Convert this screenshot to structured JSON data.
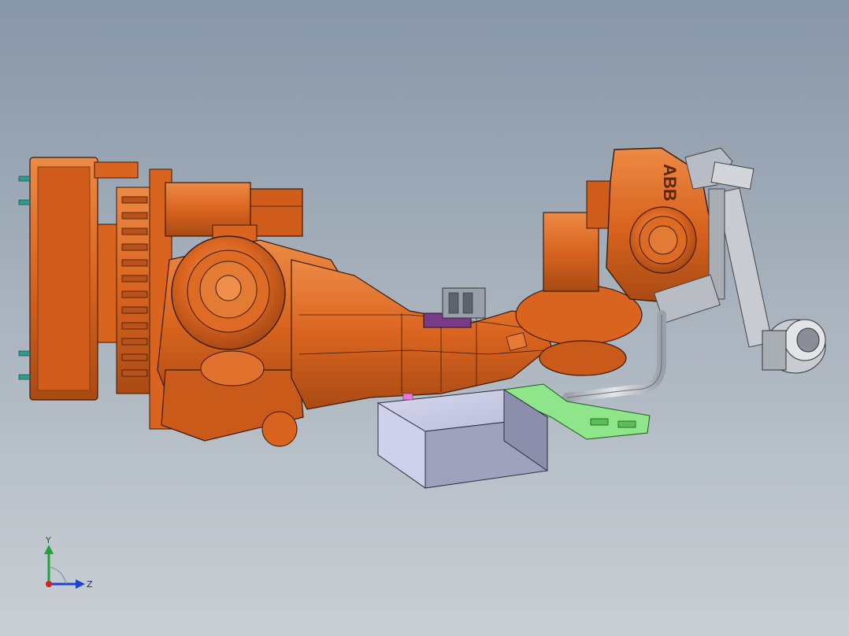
{
  "viewport": {
    "background_top": "#8796a8",
    "background_bottom": "#c9cfd4"
  },
  "model": {
    "body_color": "#d9641f",
    "body_shadow": "#b04e15",
    "body_highlight": "#ec8a45",
    "edge_color": "#3a1a08",
    "enclosure_color": "#c9cbe6",
    "enclosure_side": "#9fa2bd",
    "bracket_color": "#8ee58a",
    "cable_color": "#bfc3c9",
    "gripper_color": "#c8ccd2",
    "connector_color": "#7a3a8a",
    "logo_text": "ABB"
  },
  "triad": {
    "y_label": "Y",
    "z_label": "Z",
    "y_color": "#1fa33a",
    "z_color": "#2040d0",
    "origin_color": "#d02020"
  }
}
